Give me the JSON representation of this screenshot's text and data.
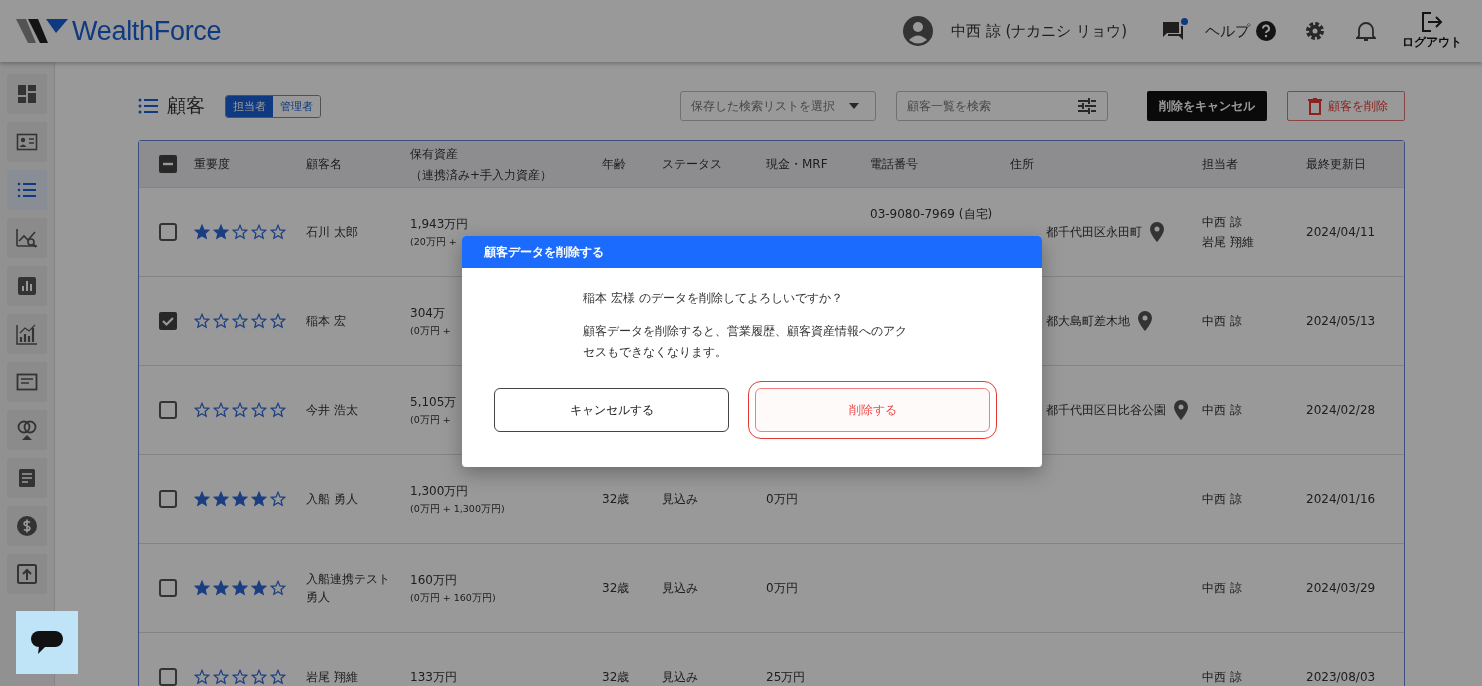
{
  "header": {
    "logo": "WealthForce",
    "user_name": "中西 諒 (ナカニシ リョウ)",
    "messages_unread": true,
    "help_label": "ヘルプ",
    "logout_label": "ログアウト"
  },
  "sidebar": {
    "items": [
      {
        "kind": "dashboard",
        "selected": false
      },
      {
        "kind": "profile",
        "selected": false
      },
      {
        "kind": "list",
        "selected": true
      },
      {
        "kind": "analysis",
        "selected": false
      },
      {
        "kind": "report",
        "selected": false
      },
      {
        "kind": "growth",
        "selected": false
      },
      {
        "kind": "window",
        "selected": false
      },
      {
        "kind": "rings",
        "selected": false
      },
      {
        "kind": "document",
        "selected": false
      },
      {
        "kind": "dollar",
        "selected": false
      },
      {
        "kind": "upload",
        "selected": false
      }
    ]
  },
  "toolbar": {
    "title": "顧客",
    "scope_tabs": [
      {
        "label": "担当者",
        "selected": true
      },
      {
        "label": "管理者",
        "selected": false
      }
    ],
    "saved_search": {
      "placeholder": "保存した検索リストを選択"
    },
    "search": {
      "placeholder": "顧客一覧を検索"
    },
    "cancel_delete_button": "削除をキャンセル",
    "delete_button": "顧客を削除"
  },
  "table": {
    "select_all_indeterminate": true,
    "columns": [
      {
        "label": "重要度"
      },
      {
        "label": "顧客名"
      },
      {
        "label": "保有資産",
        "note": "（連携済み+手入力資産）"
      },
      {
        "label": "年齢"
      },
      {
        "label": "ステータス"
      },
      {
        "label": "現金・MRF"
      },
      {
        "label": "電話番号"
      },
      {
        "label": "住所"
      },
      {
        "label": "担当者"
      },
      {
        "label": "最終更新日"
      }
    ],
    "rows": [
      {
        "checked": false,
        "stars": 2,
        "name": "石川 太郎",
        "assets": "1,943万円",
        "assets_detail": "(20万円 +",
        "phones": [
          "03-9080-7969 (自宅)"
        ],
        "address": "都千代田区永田町",
        "address_cut": true,
        "managers": [
          "中西 諒",
          "岩尾 翔維"
        ],
        "updated": "2024/04/11"
      },
      {
        "checked": true,
        "stars": 0,
        "name": "稲本 宏",
        "assets": "304万",
        "assets_detail": "(0万円 +",
        "phones": [],
        "address": "都大島町差木地",
        "address_cut": true,
        "managers": [
          "中西 諒"
        ],
        "updated": "2024/05/13"
      },
      {
        "checked": false,
        "stars": 0,
        "name": "今井 浩太",
        "assets": "5,105万",
        "assets_detail": "(0万円 +",
        "phones": [],
        "address": "都千代田区日比谷公園",
        "address_cut": true,
        "managers": [
          "中西 諒"
        ],
        "updated": "2024/02/28"
      },
      {
        "checked": false,
        "stars": 4,
        "name": "入船 勇人",
        "assets": "1,300万円",
        "assets_detail": "(0万円 + 1,300万円)",
        "age": "32歳",
        "status": "見込み",
        "cash": "0万円",
        "phones": [],
        "managers": [
          "中西 諒"
        ],
        "updated": "2024/01/16"
      },
      {
        "checked": false,
        "stars": 4,
        "name": "入船連携テスト勇人",
        "assets": "160万円",
        "assets_detail": "(0万円 + 160万円)",
        "age": "32歳",
        "status": "見込み",
        "cash": "0万円",
        "phones": [],
        "managers": [
          "中西 諒"
        ],
        "updated": "2024/03/29"
      },
      {
        "checked": false,
        "stars": 0,
        "name": "岩尾 翔維",
        "assets": "133万円",
        "age": "32歳",
        "status": "見込み",
        "cash": "25万円",
        "phones": [],
        "managers": [
          "中西 諒"
        ],
        "updated": "2023/08/03"
      }
    ]
  },
  "dialog": {
    "title": "顧客データを削除する",
    "question": "稲本 宏様 のデータを削除してよろしいですか？",
    "warning": "顧客データを削除すると、営業履歴、顧客資産情報へのアクセスもできなくなります。",
    "cancel_button": "キャンセルする",
    "confirm_button": "削除する",
    "confirm_focused": true
  }
}
